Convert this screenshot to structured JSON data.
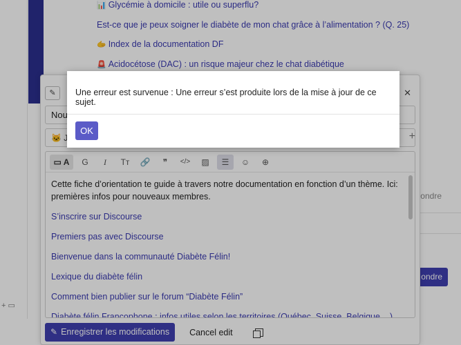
{
  "background": {
    "links": [
      {
        "emoji": "📊",
        "text": "Glycémie à domicile : utile ou superflu?"
      },
      {
        "emoji": "",
        "text": "Est-ce que je peux soigner le diabète de mon chat grâce à l’alimentation ? (Q. 25)"
      },
      {
        "emoji": "🫱",
        "text": "Index de la documentation DF"
      },
      {
        "emoji": "🚨",
        "text": "Acidocétose (DAC) : un risque majeur chez le chat diabétique"
      }
    ],
    "right_text": "ondre",
    "right_button": "ondre"
  },
  "composer": {
    "title_value": "Nouv",
    "category_value": "Je",
    "category_emoji": "🐱",
    "toolbar": [
      {
        "icon": "font-size-icon",
        "glyph": "A"
      },
      {
        "icon": "grid-icon",
        "glyph": "G"
      },
      {
        "icon": "italic-icon",
        "glyph": "I"
      },
      {
        "icon": "heading-icon",
        "glyph": "Tт"
      },
      {
        "icon": "link-icon",
        "glyph": "🔗"
      },
      {
        "icon": "quote-icon",
        "glyph": "❞"
      },
      {
        "icon": "code-icon",
        "glyph": "</>"
      },
      {
        "icon": "image-icon",
        "glyph": "▨"
      },
      {
        "icon": "list-icon",
        "glyph": "☰"
      },
      {
        "icon": "emoji-icon",
        "glyph": "☺"
      },
      {
        "icon": "add-icon",
        "glyph": "⊕"
      }
    ],
    "content": {
      "intro": "Cette fiche d’orientation te guide à travers notre documentation en fonction d’un thème. Ici: premières infos pour nouveaux membres.",
      "links": [
        "S’inscrire sur Discourse",
        "Premiers pas avec Discourse",
        "Bienvenue dans la communauté Diabète Félin!",
        "Lexique du diabète félin",
        "Comment bien publier sur le forum “Diabète Félin”",
        "Diabète félin Francophone : infos utiles selon les territoires (Québec, Suisse, Belgique,...)"
      ]
    },
    "save_label": "Enregistrer les modifications",
    "cancel_label": "Cancel edit"
  },
  "modal": {
    "message": "Une erreur est survenue : Une erreur s’est produite lors de la mise à jour de ce sujet.",
    "ok_label": "OK"
  },
  "colors": {
    "primary": "#3f3fb0",
    "ok_button": "#5b5bc7",
    "link": "#3a3ab0"
  }
}
